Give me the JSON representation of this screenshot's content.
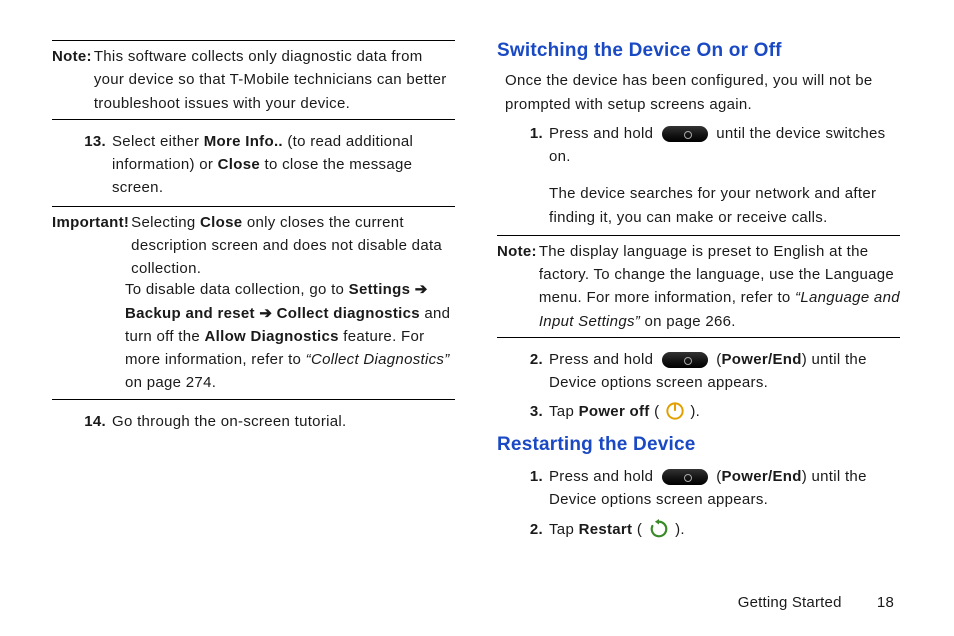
{
  "left": {
    "note": {
      "lead": "Note:",
      "text": "This software collects only diagnostic data from your device so that T-Mobile technicians can better troubleshoot issues with your device."
    },
    "step13": {
      "num": "13.",
      "pre": "Select either ",
      "bold1": "More Info..",
      "mid": " (to read additional information) or ",
      "bold2": "Close",
      "post": " to close the message screen."
    },
    "important": {
      "lead": "Important!",
      "l1a": " Selecting ",
      "l1b": "Close",
      "l1c": " only closes the current description screen and does not disable data collection.",
      "l2a": "To disable data collection, go to ",
      "l2b": "Settings ➔ Backup and reset ➔ Collect diagnostics",
      "l2c": " and turn off the ",
      "l2d": "Allow Diagnostics",
      "l2e": " feature. For more information, refer to ",
      "l2f": "“Collect Diagnostics”",
      "l2g": "  on page 274."
    },
    "step14": {
      "num": "14.",
      "text": "Go through the on-screen tutorial."
    }
  },
  "right": {
    "h1": "Switching the Device On or Off",
    "intro": "Once the device has been configured, you will not be prompted with setup screens again.",
    "s1": {
      "num": "1.",
      "pre": "Press and hold ",
      "post": " until the device switches on.",
      "sub": "The device searches for your network and after finding it, you can make or receive calls."
    },
    "note": {
      "lead": "Note:",
      "a": "The display language is preset to English at the factory. To change the language, use the Language menu. For more information, refer to ",
      "b": "“Language and Input Settings”",
      "c": "  on page 266."
    },
    "s2": {
      "num": "2.",
      "pre": "Press and hold ",
      "lp": " (",
      "bold": "Power/End",
      "post": ") until the Device options screen appears."
    },
    "s3": {
      "num": "3.",
      "pre": "Tap ",
      "bold": "Power off",
      "lp": " ( ",
      "rp": " )."
    },
    "h2": "Restarting the Device",
    "r1": {
      "num": "1.",
      "pre": "Press and hold ",
      "lp": " (",
      "bold": "Power/End",
      "post": ") until the Device options screen appears."
    },
    "r2": {
      "num": "2.",
      "pre": "Tap ",
      "bold": "Restart",
      "lp": " ( ",
      "rp": " )."
    }
  },
  "footer": {
    "section": "Getting Started",
    "page": "18"
  }
}
